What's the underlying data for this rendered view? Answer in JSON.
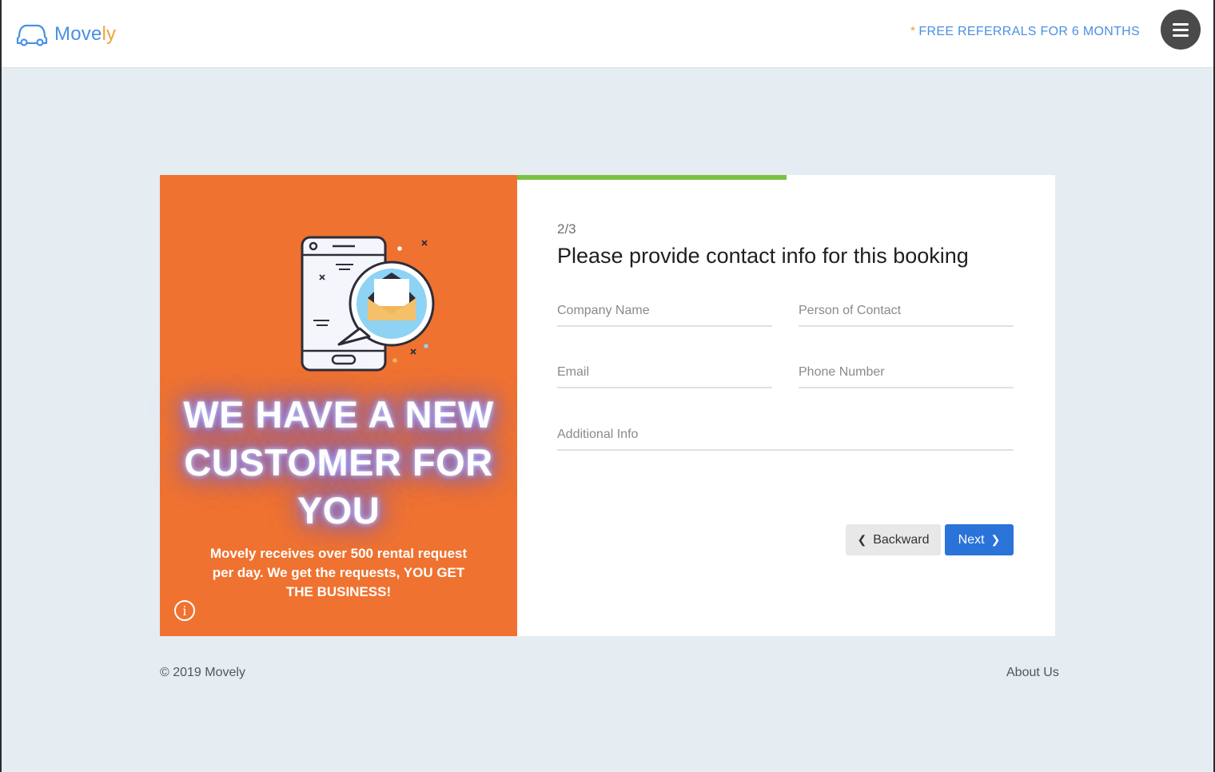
{
  "header": {
    "logo_text_main": "Move",
    "logo_text_accent": "ly",
    "referral_star": "*",
    "referral_text": "FREE REFERRALS FOR 6 MONTHS"
  },
  "promo": {
    "title": "WE HAVE A NEW CUSTOMER FOR YOU",
    "subtitle": "Movely receives over 500 rental request per day. We get the requests, YOU GET THE BUSINESS!",
    "info_icon": "i"
  },
  "form": {
    "progress_fraction": 0.5,
    "step": "2/3",
    "title": "Please provide contact info for this booking",
    "fields": {
      "company_name": {
        "placeholder": "Company Name",
        "value": ""
      },
      "person_of_contact": {
        "placeholder": "Person of Contact",
        "value": ""
      },
      "email": {
        "placeholder": "Email",
        "value": ""
      },
      "phone_number": {
        "placeholder": "Phone Number",
        "value": ""
      },
      "additional_info": {
        "placeholder": "Additional Info",
        "value": ""
      }
    },
    "buttons": {
      "back_label": "Backward",
      "back_icon": "chevron-left-icon",
      "next_label": "Next",
      "next_icon": "chevron-right-icon"
    }
  },
  "footer": {
    "copyright": "© 2019 Movely",
    "about": "About Us"
  },
  "colors": {
    "accent_blue": "#4a90e2",
    "accent_orange": "#f0a23b",
    "promo_bg": "#ef7230",
    "progress_green": "#7ac143",
    "next_button": "#2a73d9",
    "page_bg": "#e5ecf2"
  },
  "icons": {
    "logo": "car-icon",
    "menu": "hamburger-menu-icon",
    "illustration": "phone-message-envelope-illustration",
    "info": "info-icon"
  }
}
